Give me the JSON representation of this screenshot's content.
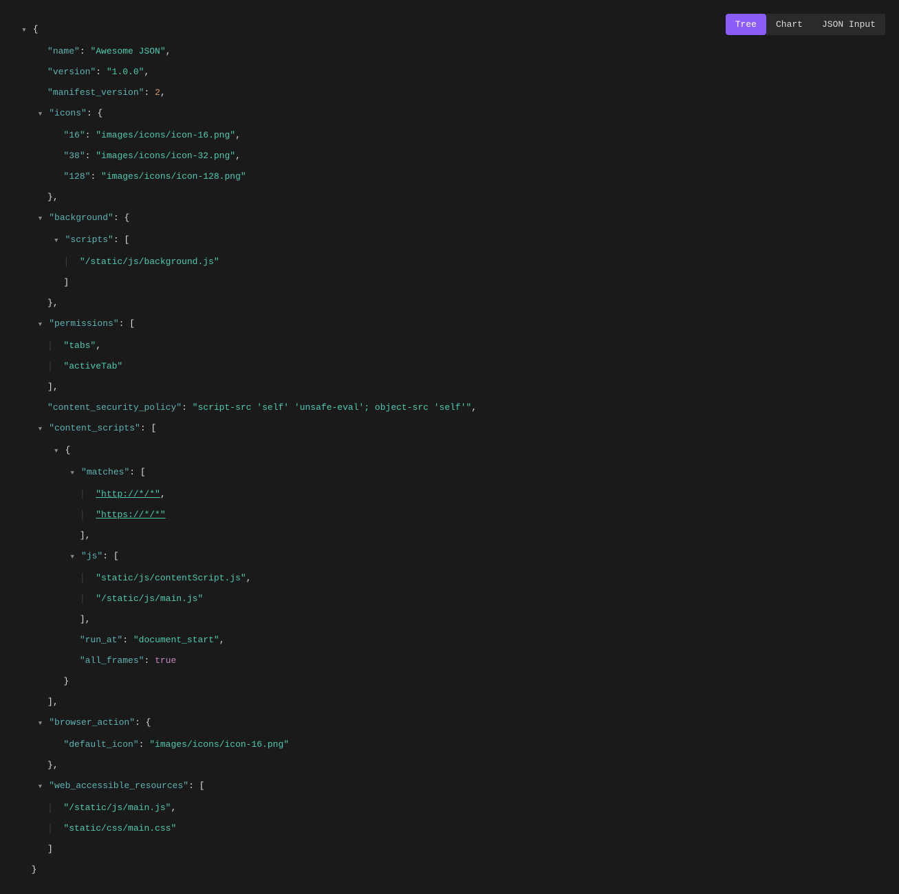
{
  "tabs": {
    "tree": "Tree",
    "chart": "Chart",
    "jsonInput": "JSON Input"
  },
  "json": {
    "name_key": "\"name\"",
    "name_val": "\"Awesome JSON\"",
    "version_key": "\"version\"",
    "version_val": "\"1.0.0\"",
    "manifest_version_key": "\"manifest_version\"",
    "manifest_version_val": "2",
    "icons_key": "\"icons\"",
    "icon16_key": "\"16\"",
    "icon16_val": "\"images/icons/icon-16.png\"",
    "icon38_key": "\"38\"",
    "icon38_val": "\"images/icons/icon-32.png\"",
    "icon128_key": "\"128\"",
    "icon128_val": "\"images/icons/icon-128.png\"",
    "background_key": "\"background\"",
    "scripts_key": "\"scripts\"",
    "bg_script_val": "\"/static/js/background.js\"",
    "permissions_key": "\"permissions\"",
    "perm_tabs_val": "\"tabs\"",
    "perm_active_val": "\"activeTab\"",
    "csp_key": "\"content_security_policy\"",
    "csp_val": "\"script-src 'self' 'unsafe-eval'; object-src 'self'\"",
    "content_scripts_key": "\"content_scripts\"",
    "matches_key": "\"matches\"",
    "match_http_val": "\"http://*/*\"",
    "match_https_val": "\"https://*/*\"",
    "js_key": "\"js\"",
    "js_content_val": "\"static/js/contentScript.js\"",
    "js_main_val": "\"/static/js/main.js\"",
    "run_at_key": "\"run_at\"",
    "run_at_val": "\"document_start\"",
    "all_frames_key": "\"all_frames\"",
    "all_frames_val": "true",
    "browser_action_key": "\"browser_action\"",
    "default_icon_key": "\"default_icon\"",
    "default_icon_val": "\"images/icons/icon-16.png\"",
    "war_key": "\"web_accessible_resources\"",
    "war_js_val": "\"/static/js/main.js\"",
    "war_css_val": "\"static/css/main.css\""
  }
}
